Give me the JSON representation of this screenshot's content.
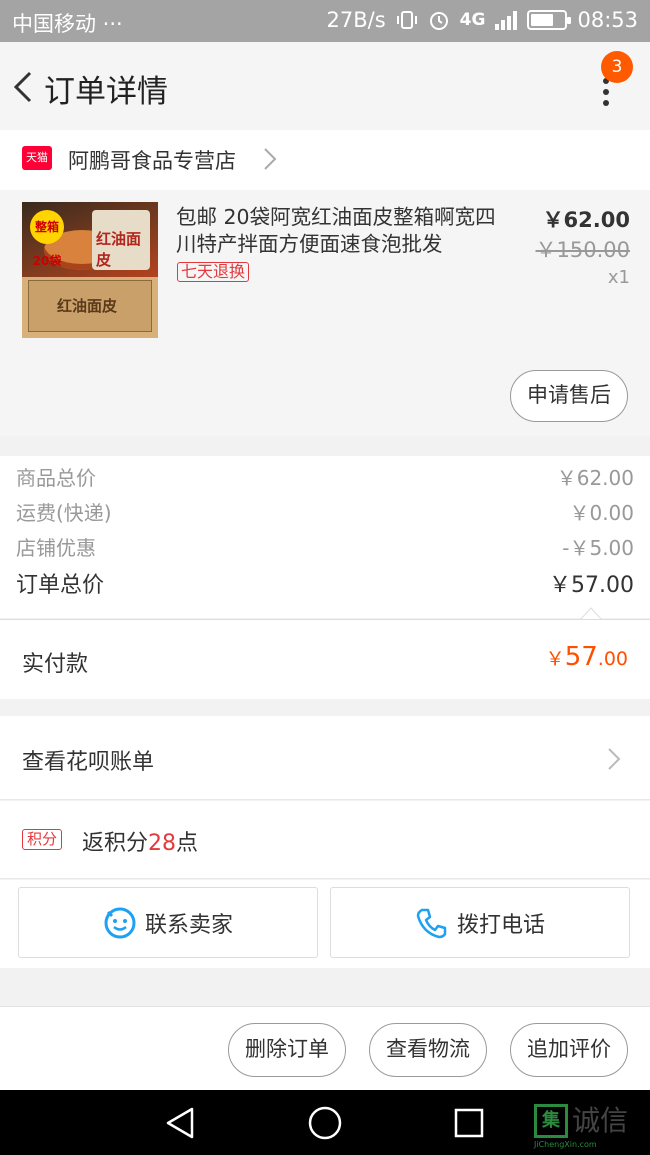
{
  "status_bar": {
    "carrier": "中国移动 ···",
    "speed": "27B/s",
    "network": "4G",
    "time": "08:53"
  },
  "header": {
    "title": "订单详情",
    "notification_count": "3"
  },
  "store": {
    "badge_text": "天猫",
    "name": "阿鹏哥食品专营店"
  },
  "product": {
    "name": "包邮 20袋阿宽红油面皮整箱啊宽四川特产拌面方便面速食泡批发",
    "tag": "七天退换",
    "price": "￥62.00",
    "original_price": "￥150.00",
    "quantity": "x1",
    "after_sale_label": "申请售后",
    "thumb_badge": "整箱20袋",
    "thumb_bag_text": "红油面皮",
    "thumb_box_text": "红油面皮"
  },
  "summary": {
    "rows": [
      {
        "label": "商品总价",
        "value": "￥62.00"
      },
      {
        "label": "运费(快递)",
        "value": "￥0.00"
      },
      {
        "label": "店铺优惠",
        "value": "-￥5.00"
      }
    ],
    "total_label": "订单总价",
    "total_value": "￥57.00"
  },
  "payment": {
    "label": "实付款",
    "currency": "￥",
    "amount_int": "57",
    "amount_dec": ".00",
    "accent_color": "#ff5000"
  },
  "huabei": {
    "label": "查看花呗账单"
  },
  "points": {
    "badge": "积分",
    "prefix": "返积分",
    "value": "28",
    "suffix": "点"
  },
  "contact": {
    "seller_label": "联系卖家",
    "call_label": "拨打电话"
  },
  "actions": {
    "delete_label": "删除订单",
    "logistics_label": "查看物流",
    "review_label": "追加评价"
  },
  "watermark": {
    "char": "集",
    "text": "诚信",
    "url": "JiChengXin.com"
  }
}
